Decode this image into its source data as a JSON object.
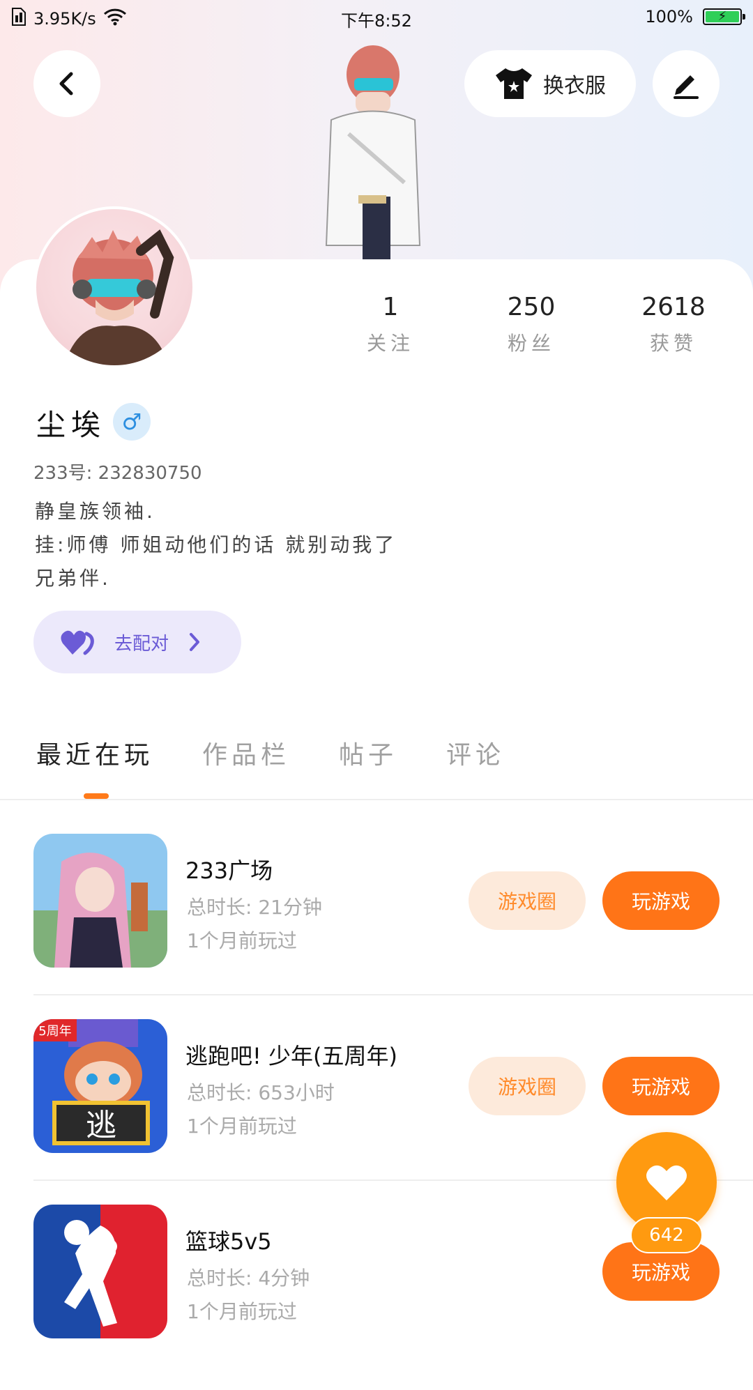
{
  "status_bar": {
    "speed": "3.95K/s",
    "time": "下午8:52",
    "battery": "100%"
  },
  "header": {
    "outfit_label": "换衣服"
  },
  "profile": {
    "stats": [
      {
        "value": "1",
        "label": "关注"
      },
      {
        "value": "250",
        "label": "粉丝"
      },
      {
        "value": "2618",
        "label": "获赞"
      }
    ],
    "name": "尘埃",
    "gender_symbol": "♂",
    "uid": "233号: 232830750",
    "bio": [
      "静皇族领袖.",
      "挂:师傅 师姐动他们的话 就别动我了",
      "兄弟伴."
    ],
    "match_label": "去配对"
  },
  "tabs": [
    "最近在玩",
    "作品栏",
    "帖子",
    "评论"
  ],
  "games": [
    {
      "title": "233广场",
      "duration": "总时长: 21分钟",
      "last": "1个月前玩过",
      "circle_label": "游戏圈",
      "play_label": "玩游戏"
    },
    {
      "title": "逃跑吧! 少年(五周年)",
      "duration": "总时长: 653小时",
      "last": "1个月前玩过",
      "circle_label": "游戏圈",
      "play_label": "玩游戏"
    },
    {
      "title": "篮球5v5",
      "duration": "总时长: 4分钟",
      "last": "1个月前玩过",
      "play_label": "玩游戏"
    }
  ],
  "icon_texts": {
    "badge_5year": "5周年",
    "tao": "逃"
  },
  "like": {
    "count": "642"
  },
  "colors": {
    "accent": "#ff7417",
    "light_accent": "#fdeadb",
    "match_bg": "#ece9fb",
    "match_text": "#6b5bd6",
    "gender_blue": "#2d8fe0"
  }
}
